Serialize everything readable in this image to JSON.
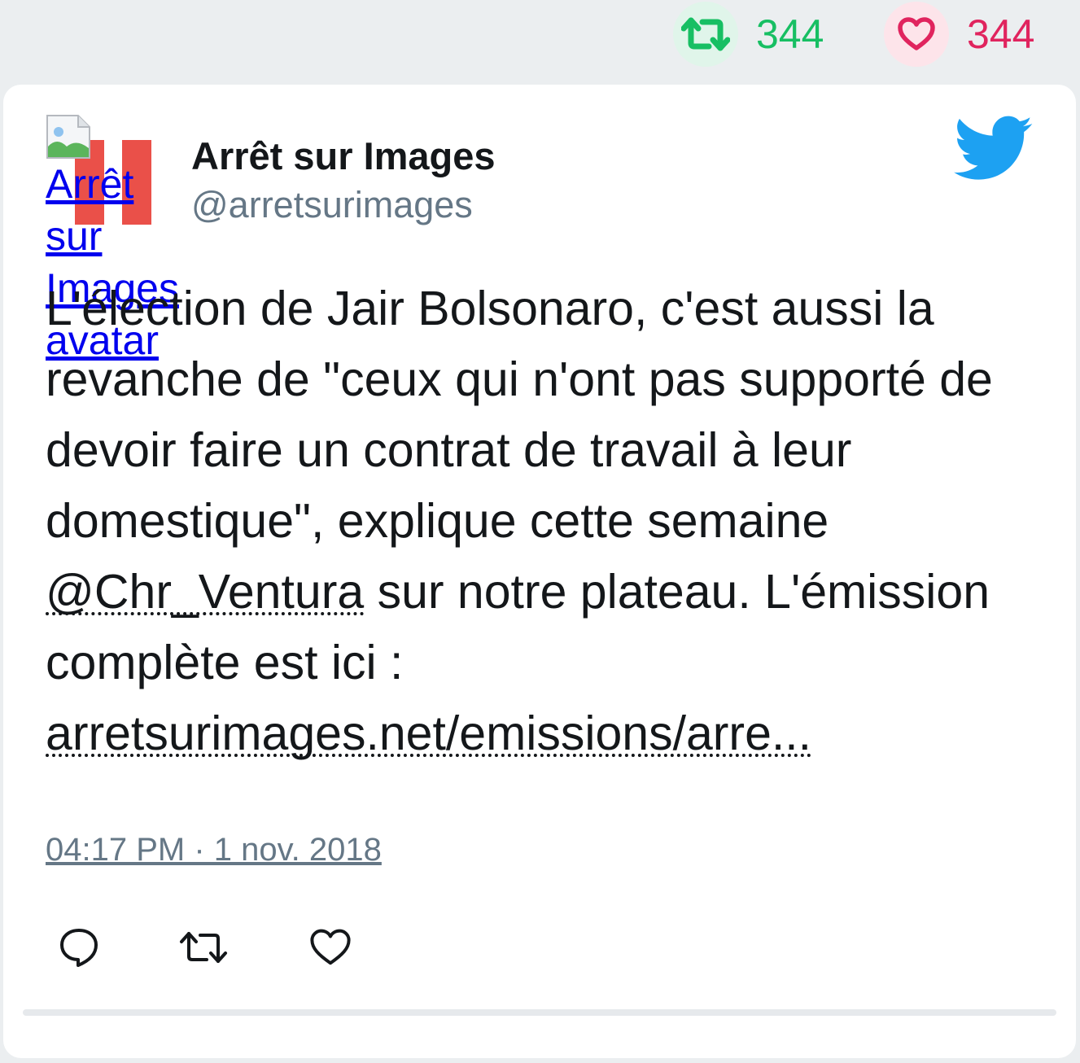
{
  "stats": {
    "retweets": "344",
    "likes": "344"
  },
  "tweet": {
    "author_name": "Arrêt sur Images",
    "author_handle": "@arretsurimages",
    "avatar_alt": "Arrêt sur Images avatar",
    "text_before_mention": "L'élection de Jair Bolsonaro, c'est aussi la revanche de \"ceux qui n'ont pas supporté de devoir faire un contrat de travail à leur domestique\", explique cette semaine ",
    "mention": "@Chr_Ventura",
    "text_after_mention": " sur notre plateau. L'émission complète est ici : ",
    "link": "arretsurimages.net/emissions/arre...",
    "timestamp": "04:17 PM · 1 nov. 2018"
  },
  "colors": {
    "retweet": "#17bf63",
    "like": "#e0245e",
    "twitter_blue": "#1da1f2",
    "muted": "#657786",
    "text": "#14171a"
  },
  "icons": {
    "retweet": "retweet-icon",
    "like": "heart-icon",
    "reply": "reply-icon",
    "brand": "twitter-bird-icon"
  }
}
